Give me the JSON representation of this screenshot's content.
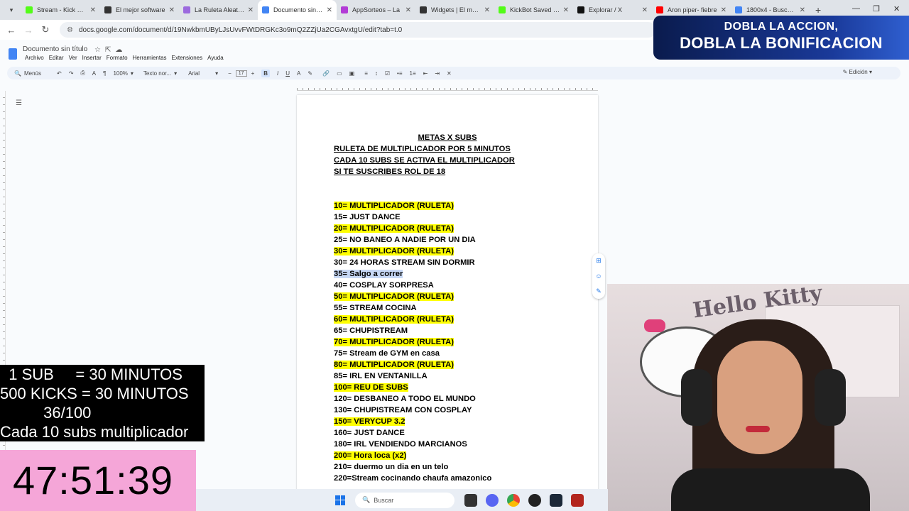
{
  "browser": {
    "tabs": [
      {
        "title": "Stream - Kick Dash",
        "color": "#53fc18",
        "active": false
      },
      {
        "title": "El mejor software",
        "color": "#333333",
        "active": false
      },
      {
        "title": "La Ruleta Aleatoria",
        "color": "#9c6ade",
        "active": false
      },
      {
        "title": "Documento sin título",
        "color": "#4285f4",
        "active": true
      },
      {
        "title": "AppSorteos – La",
        "color": "#b23bd6",
        "active": false
      },
      {
        "title": "Widgets | El mejor",
        "color": "#333333",
        "active": false
      },
      {
        "title": "KickBot Saved Wi",
        "color": "#53fc18",
        "active": false
      },
      {
        "title": "Explorar / X",
        "color": "#111111",
        "active": false
      },
      {
        "title": "Aron piper- fiebre",
        "color": "#ff0000",
        "active": false
      },
      {
        "title": "1800x4 - Buscar c",
        "color": "#4285f4",
        "active": false
      }
    ],
    "url": "docs.google.com/document/d/19NwkbmUByLJsUvvFWtDRGKc3o9mQ2ZZjUa2CGAvxtgU/edit?tab=t.0"
  },
  "docs": {
    "title": "Documento sin título",
    "menus": [
      "Archivo",
      "Editar",
      "Ver",
      "Insertar",
      "Formato",
      "Herramientas",
      "Extensiones",
      "Ayuda"
    ],
    "toolbar": {
      "menus_label": "Menús",
      "zoom": "100%",
      "style": "Texto nor...",
      "font": "Arial",
      "font_size": "17",
      "mode": "Edición"
    },
    "heading": "METAS X SUBS",
    "subheadings": [
      "RULETA DE MULTIPLICADOR POR 5 MINUTOS",
      "CADA 10 SUBS SE ACTIVA EL MULTIPLICADOR",
      "SI TE SUSCRIBES ROL DE 18"
    ],
    "goals": [
      {
        "text": "10= MULTIPLICADOR (RULETA)",
        "style": "hl"
      },
      {
        "text": "15= JUST DANCE",
        "style": ""
      },
      {
        "text": "20= MULTIPLICADOR (RULETA)",
        "style": "hl"
      },
      {
        "text": "25= NO BANEO A NADIE POR UN DIA",
        "style": ""
      },
      {
        "text": "30= MULTIPLICADOR (RULETA)",
        "style": "hl"
      },
      {
        "text": "30= 24 HORAS STREAM SIN DORMIR",
        "style": ""
      },
      {
        "text": "35= Salgo a correr",
        "style": "sel"
      },
      {
        "text": "40= COSPLAY SORPRESA",
        "style": ""
      },
      {
        "text": "50=  MULTIPLICADOR (RULETA)",
        "style": "hl"
      },
      {
        "text": "55= STREAM COCINA",
        "style": ""
      },
      {
        "text": "60=  MULTIPLICADOR (RULETA)",
        "style": "hl"
      },
      {
        "text": "65= CHUPISTREAM",
        "style": ""
      },
      {
        "text": "70=  MULTIPLICADOR (RULETA)",
        "style": "hl"
      },
      {
        "text": "75= Stream de GYM en casa",
        "style": ""
      },
      {
        "text": "80=  MULTIPLICADOR (RULETA)",
        "style": "hl"
      },
      {
        "text": "85= IRL EN VENTANILLA",
        "style": ""
      },
      {
        "text": "100= REU DE SUBS",
        "style": "hl"
      },
      {
        "text": "120= DESBANEO A TODO EL MUNDO",
        "style": ""
      },
      {
        "text": "130= CHUPISTREAM CON COSPLAY",
        "style": ""
      },
      {
        "text": "150= VERYCUP 3.2",
        "style": "hl"
      },
      {
        "text": "160= JUST DANCE",
        "style": ""
      },
      {
        "text": "180= IRL VENDIENDO MARCIANOS",
        "style": ""
      },
      {
        "text": "200= Hora loca (x2)",
        "style": "hl"
      },
      {
        "text": "210= duermo un dia en un telo",
        "style": ""
      },
      {
        "text": "220=Stream cocinando chaufa amazonico",
        "style": ""
      }
    ]
  },
  "overlay": {
    "banner_line1": "DOBLA LA ACCION,",
    "banner_line2": "DOBLA LA BONIFICACION",
    "sub_info": "  1 SUB     = 30 MINUTOS\n500 KICKS = 30 MINUTOS\n          36/100\nCada 10 subs multiplicador",
    "timer": "47:51:39",
    "webcam_text": "Hello Kitty"
  },
  "taskbar": {
    "search_placeholder": "Buscar"
  }
}
